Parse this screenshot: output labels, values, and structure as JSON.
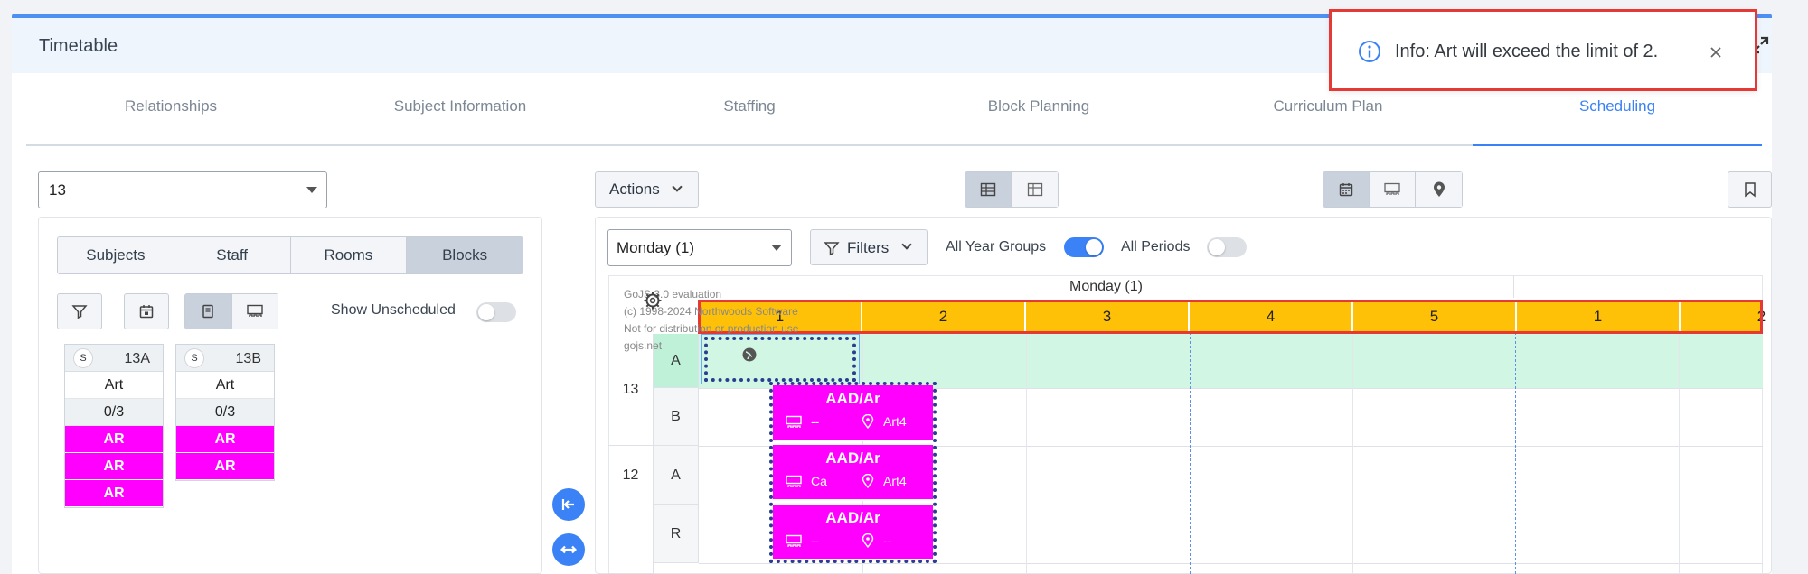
{
  "header": {
    "title": "Timetable"
  },
  "tabs": [
    {
      "label": "Relationships"
    },
    {
      "label": "Subject Information"
    },
    {
      "label": "Staffing"
    },
    {
      "label": "Block Planning"
    },
    {
      "label": "Curriculum Plan"
    },
    {
      "label": "Scheduling"
    }
  ],
  "active_tab": "Scheduling",
  "left": {
    "year_select": "13",
    "segments": [
      "Subjects",
      "Staff",
      "Rooms",
      "Blocks"
    ],
    "selected_segment": "Blocks",
    "show_unscheduled_label": "Show Unscheduled",
    "show_unscheduled_on": false,
    "blocks": [
      {
        "badge": "S",
        "name": "13A",
        "subject": "Art",
        "count": "0/3",
        "items": [
          "AR",
          "AR",
          "AR"
        ]
      },
      {
        "badge": "S",
        "name": "13B",
        "subject": "Art",
        "count": "0/3",
        "items": [
          "AR",
          "AR"
        ]
      }
    ]
  },
  "toolbar": {
    "actions_label": "Actions"
  },
  "filters": {
    "day_select": "Monday (1)",
    "filters_label": "Filters",
    "all_year_groups_label": "All Year Groups",
    "all_year_groups_on": true,
    "all_periods_label": "All Periods",
    "all_periods_on": false
  },
  "grid": {
    "watermark": [
      "GoJS 3.0 evaluation",
      "(c) 1998-2024 Northwoods Software",
      "Not for distribution or production use",
      "gojs.net"
    ],
    "day_header": "Monday (1)",
    "periods": [
      "1",
      "2",
      "3",
      "4",
      "5",
      "1",
      "2"
    ],
    "rows": [
      {
        "year": "13",
        "group": "A"
      },
      {
        "year": "",
        "group": "B"
      },
      {
        "year": "12",
        "group": "A"
      },
      {
        "year": "",
        "group": "R"
      }
    ],
    "lessons": [
      {
        "title": "AAD/Ar",
        "room": "--",
        "location": "Art4"
      },
      {
        "title": "AAD/Ar",
        "room": "Ca",
        "location": "Art4"
      },
      {
        "title": "AAD/Ar",
        "room": "--",
        "location": "--"
      }
    ]
  },
  "toast": {
    "message": "Info: Art will exceed the limit of 2."
  },
  "colors": {
    "accent": "#3b82f6",
    "lesson": "#ff00ff",
    "period": "#ffc107",
    "row_highlight": "#d1f7e4",
    "alert_outline": "#e53935"
  }
}
